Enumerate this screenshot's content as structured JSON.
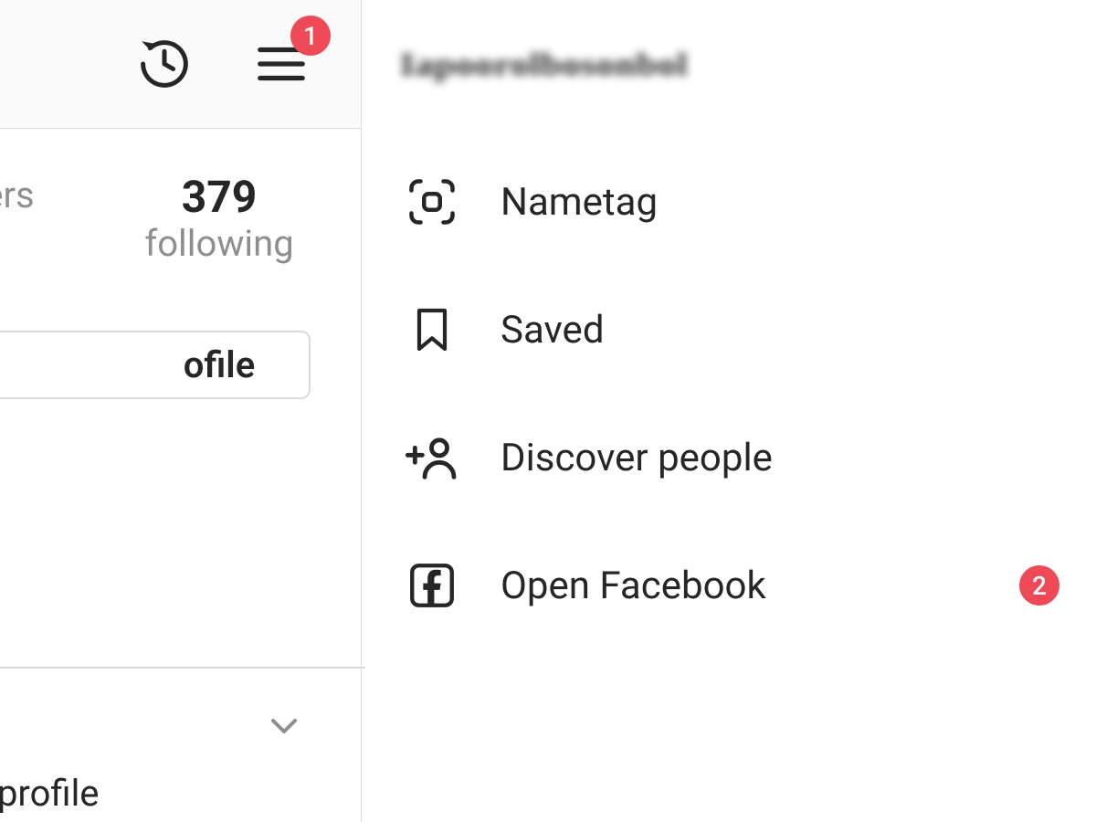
{
  "colors": {
    "badge": "#ed4956",
    "text": "#262626",
    "muted": "#8e8e8e",
    "border": "#dbdbdb",
    "header_bg": "#fafafa"
  },
  "header": {
    "menu_badge": "1"
  },
  "profile": {
    "followers_count_fragment": "",
    "followers_label_fragment": "ers",
    "following_count": "379",
    "following_label": "following",
    "edit_button_label_fragment": "ofile",
    "your_profile_fragment": "your profile"
  },
  "drawer": {
    "username_obscured": "Iapoorolbosonbol",
    "items": [
      {
        "icon": "nametag-icon",
        "label": "Nametag",
        "badge": null
      },
      {
        "icon": "bookmark-icon",
        "label": "Saved",
        "badge": null
      },
      {
        "icon": "add-person-icon",
        "label": "Discover people",
        "badge": null
      },
      {
        "icon": "facebook-icon",
        "label": "Open Facebook",
        "badge": "2"
      }
    ]
  }
}
